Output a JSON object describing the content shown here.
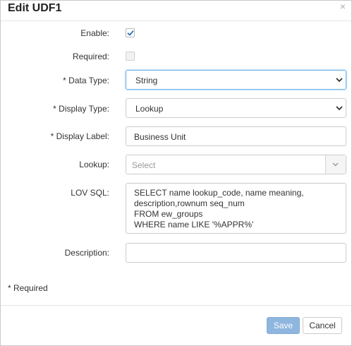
{
  "dialog": {
    "title": "Edit UDF1",
    "close_glyph": "×"
  },
  "form": {
    "enable": {
      "label": "Enable:",
      "checked": true
    },
    "required": {
      "label": "Required:",
      "checked": false
    },
    "data_type": {
      "label": "* Data Type:",
      "value": "String"
    },
    "display_type": {
      "label": "* Display Type:",
      "value": "Lookup"
    },
    "display_label": {
      "label": "* Display Label:",
      "value": "Business Unit"
    },
    "lookup": {
      "label": "Lookup:",
      "placeholder": "Select"
    },
    "lov_sql": {
      "label": "LOV SQL:",
      "lines": [
        "SELECT name lookup_code, name meaning,",
        "description,rownum seq_num",
        "FROM ew_groups",
        "WHERE name LIKE '%APPR%'"
      ]
    },
    "description": {
      "label": "Description:",
      "value": ""
    }
  },
  "required_note": "* Required",
  "footer": {
    "save_label": "Save",
    "cancel_label": "Cancel"
  },
  "colors": {
    "primary_button": "#8fb6de",
    "checkmark": "#2a6fb5",
    "focus_border": "#66afe9"
  },
  "icons": [
    "close-icon",
    "checkmark-icon",
    "chevron-down-icon"
  ]
}
